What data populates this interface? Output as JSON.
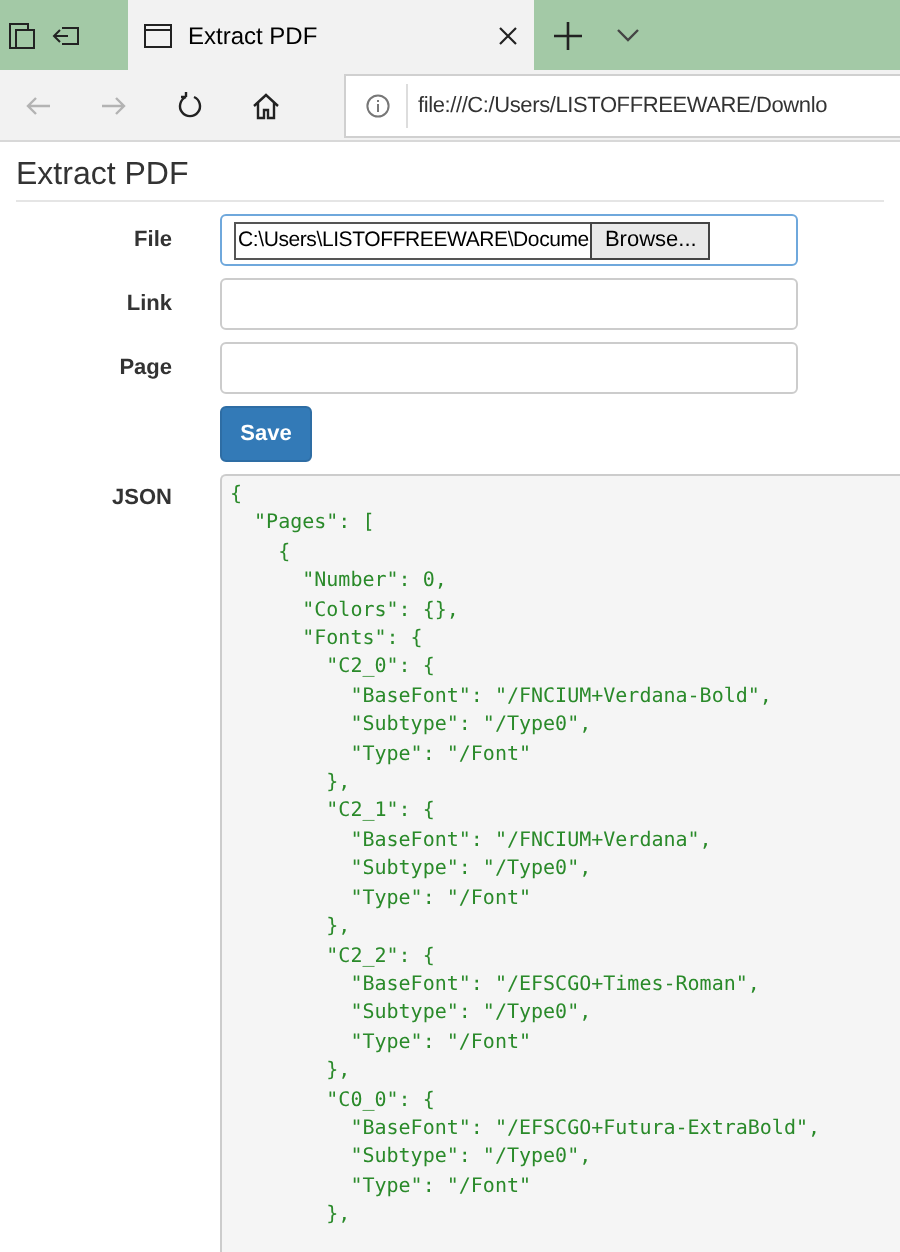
{
  "browser": {
    "tab_title": "Extract PDF",
    "address": "file:///C:/Users/LISTOFFREEWARE/Downlo",
    "nav_buttons": [
      {
        "kind": "back",
        "disabled": true
      },
      {
        "kind": "forward",
        "disabled": true
      },
      {
        "kind": "refresh",
        "disabled": false
      },
      {
        "kind": "home",
        "disabled": false
      }
    ]
  },
  "page": {
    "title": "Extract PDF",
    "fields": [
      {
        "kind": "file",
        "label": "File",
        "value": "C:\\Users\\LISTOFFREEWARE\\Docume",
        "button": "Browse..."
      },
      {
        "kind": "text",
        "label": "Link"
      },
      {
        "kind": "text",
        "label": "Page"
      }
    ],
    "save_button": "Save",
    "json_label": "JSON",
    "json_lines": [
      "{",
      "  \"Pages\": [",
      "    {",
      "      \"Number\": 0,",
      "      \"Colors\": {},",
      "      \"Fonts\": {",
      "        \"C2_0\": {",
      "          \"BaseFont\": \"/FNCIUM+Verdana-Bold\",",
      "          \"Subtype\": \"/Type0\",",
      "          \"Type\": \"/Font\"",
      "        },",
      "        \"C2_1\": {",
      "          \"BaseFont\": \"/FNCIUM+Verdana\",",
      "          \"Subtype\": \"/Type0\",",
      "          \"Type\": \"/Font\"",
      "        },",
      "        \"C2_2\": {",
      "          \"BaseFont\": \"/EFSCGO+Times-Roman\",",
      "          \"Subtype\": \"/Type0\",",
      "          \"Type\": \"/Font\"",
      "        },",
      "        \"C0_0\": {",
      "          \"BaseFont\": \"/EFSCGO+Futura-ExtraBold\",",
      "          \"Subtype\": \"/Type0\",",
      "          \"Type\": \"/Font\"",
      "        },"
    ]
  }
}
